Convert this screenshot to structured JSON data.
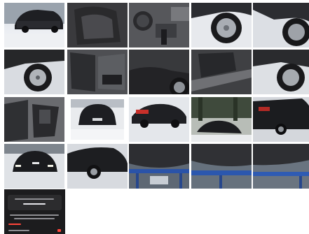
{
  "gallery": {
    "photos": [
      {
        "scene": "car-front-snow"
      },
      {
        "scene": "interior-dark"
      },
      {
        "scene": "interior-dashboard"
      },
      {
        "scene": "wheel-alloy"
      },
      {
        "scene": "wheel-snow"
      },
      {
        "scene": "wheel-side"
      },
      {
        "scene": "door-open"
      },
      {
        "scene": "wheel-arch"
      },
      {
        "scene": "door-sill"
      },
      {
        "scene": "wheel-rear"
      },
      {
        "scene": "interior-seats"
      },
      {
        "scene": "car-rear-snow"
      },
      {
        "scene": "car-side-snow"
      },
      {
        "scene": "car-in-forest"
      },
      {
        "scene": "car-rear-dark"
      },
      {
        "scene": "car-front-night"
      },
      {
        "scene": "car-side-dark"
      },
      {
        "scene": "underbody-lift"
      },
      {
        "scene": "underbody-lift-2"
      },
      {
        "scene": "underbody-lift-3"
      }
    ],
    "screenshot": {
      "scene": "phone-app-screenshot"
    }
  }
}
